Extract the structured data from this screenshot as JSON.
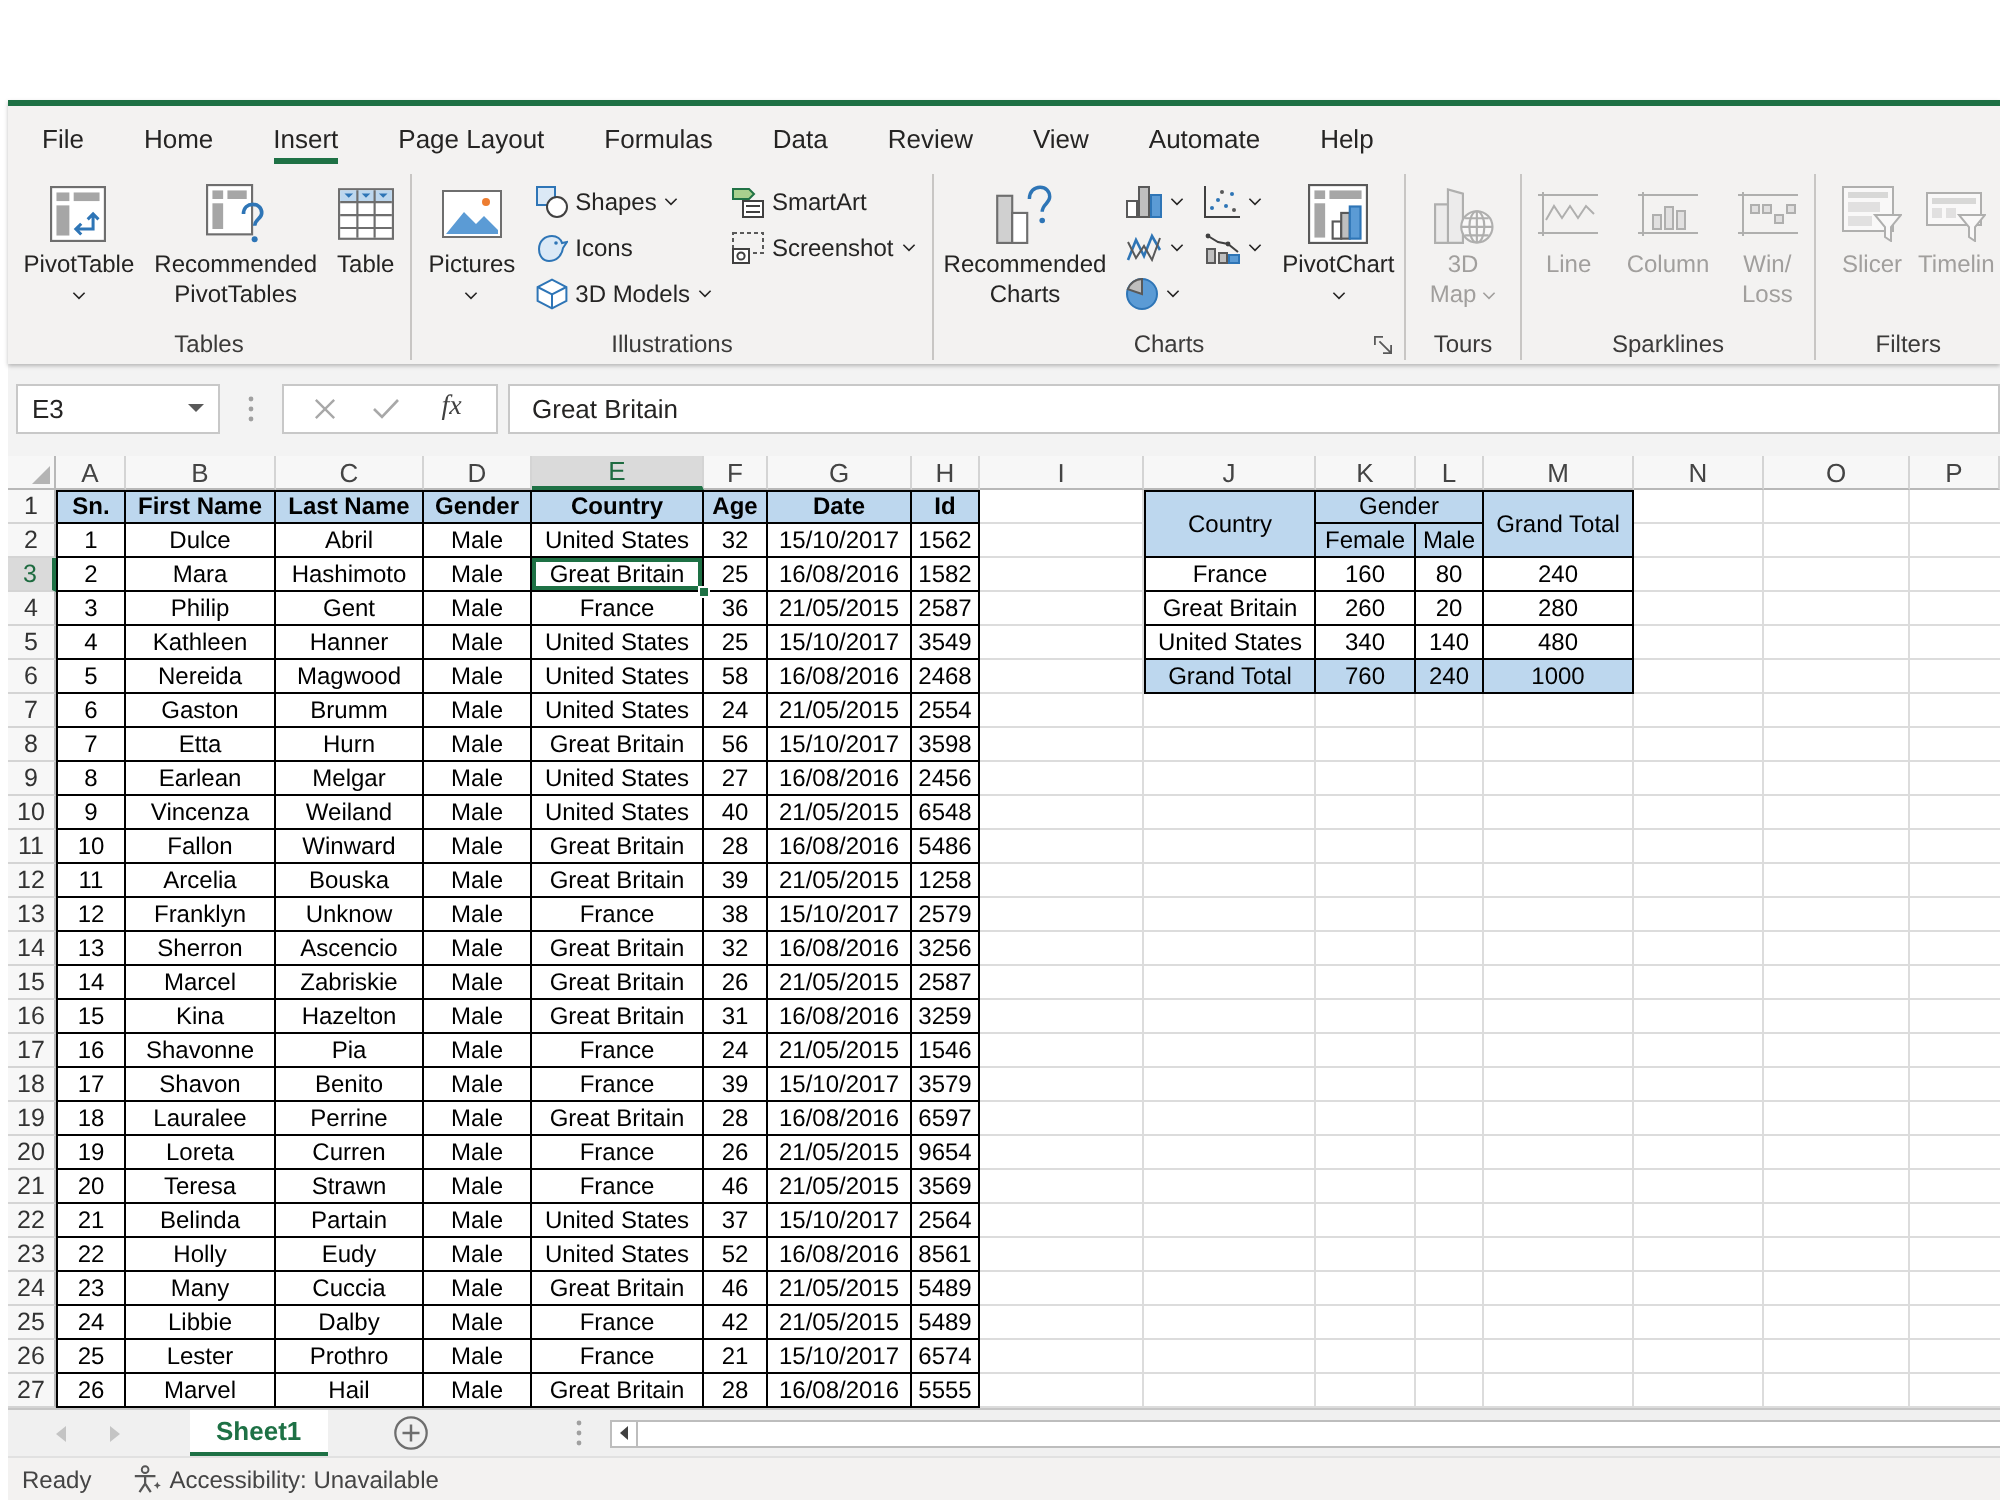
{
  "ribbon": {
    "tabs": [
      {
        "label": "File",
        "selected": false
      },
      {
        "label": "Home",
        "selected": false
      },
      {
        "label": "Insert",
        "selected": true
      },
      {
        "label": "Page Layout",
        "selected": false
      },
      {
        "label": "Formulas",
        "selected": false
      },
      {
        "label": "Data",
        "selected": false
      },
      {
        "label": "Review",
        "selected": false
      },
      {
        "label": "View",
        "selected": false
      },
      {
        "label": "Automate",
        "selected": false
      },
      {
        "label": "Help",
        "selected": false
      }
    ],
    "groups": [
      {
        "label": "Tables",
        "launcher": false,
        "columns": [
          [
            {
              "kind": "large",
              "label": "PivotTable",
              "dropdown": true,
              "disabled": false
            }
          ],
          [
            {
              "kind": "large",
              "label": "Recommended\nPivotTables",
              "dropdown": false,
              "disabled": false
            }
          ],
          [
            {
              "kind": "large",
              "label": "Table",
              "dropdown": false,
              "disabled": false
            }
          ]
        ]
      },
      {
        "label": "Illustrations",
        "launcher": false,
        "columns": [
          [
            {
              "kind": "large",
              "label": "Pictures",
              "dropdown": true,
              "disabled": false
            }
          ],
          [
            {
              "kind": "small",
              "label": "Shapes",
              "dropdown": true,
              "disabled": false
            },
            {
              "kind": "small",
              "label": "Icons",
              "dropdown": false,
              "disabled": false
            },
            {
              "kind": "small",
              "label": "3D Models",
              "dropdown": true,
              "disabled": false
            }
          ],
          [
            {
              "kind": "small",
              "label": "SmartArt",
              "dropdown": false,
              "disabled": false
            },
            {
              "kind": "small",
              "label": "Screenshot",
              "dropdown": true,
              "disabled": false
            }
          ]
        ]
      },
      {
        "label": "Charts",
        "launcher": true,
        "columns": [
          [
            {
              "kind": "large",
              "label": "Recommended\nCharts",
              "dropdown": false,
              "disabled": false
            }
          ],
          [
            {
              "kind": "icon",
              "dropdown": true,
              "disabled": false
            },
            {
              "kind": "icon",
              "dropdown": true,
              "disabled": false
            },
            {
              "kind": "icon",
              "dropdown": true,
              "disabled": false
            }
          ],
          [
            {
              "kind": "icon",
              "dropdown": true,
              "disabled": false
            },
            {
              "kind": "icon",
              "dropdown": true,
              "disabled": false
            }
          ],
          [
            {
              "kind": "large",
              "label": "PivotChart",
              "dropdown": true,
              "disabled": false
            }
          ]
        ]
      },
      {
        "label": "Tours",
        "launcher": false,
        "columns": [
          [
            {
              "kind": "large",
              "label": "3D\nMap",
              "dropdown": true,
              "disabled": true
            }
          ]
        ]
      },
      {
        "label": "Sparklines",
        "launcher": false,
        "columns": [
          [
            {
              "kind": "large",
              "label": "Line",
              "dropdown": false,
              "disabled": true
            }
          ],
          [
            {
              "kind": "large",
              "label": "Column",
              "dropdown": false,
              "disabled": true
            }
          ],
          [
            {
              "kind": "large",
              "label": "Win/\nLoss",
              "dropdown": false,
              "disabled": true
            }
          ]
        ]
      },
      {
        "label": "Filters",
        "launcher": false,
        "columns": [
          [
            {
              "kind": "large",
              "label": "Slicer",
              "dropdown": false,
              "disabled": true
            }
          ],
          [
            {
              "kind": "large",
              "label": "Timelin",
              "dropdown": false,
              "disabled": true
            }
          ]
        ]
      }
    ]
  },
  "formula_bar": {
    "name_box": "E3",
    "controls": [
      {
        "kind": "cancel",
        "disabled": true
      },
      {
        "kind": "enter",
        "disabled": true
      },
      {
        "kind": "function",
        "label": "fx",
        "disabled": false
      }
    ],
    "formula": "Great Britain"
  },
  "sheet": {
    "columns": [
      {
        "letter": "A",
        "selected": false
      },
      {
        "letter": "B",
        "selected": false
      },
      {
        "letter": "C",
        "selected": false
      },
      {
        "letter": "D",
        "selected": false
      },
      {
        "letter": "E",
        "selected": true
      },
      {
        "letter": "F",
        "selected": false
      },
      {
        "letter": "G",
        "selected": false
      },
      {
        "letter": "H",
        "selected": false
      },
      {
        "letter": "I",
        "selected": false
      },
      {
        "letter": "J",
        "selected": false
      },
      {
        "letter": "K",
        "selected": false
      },
      {
        "letter": "L",
        "selected": false
      },
      {
        "letter": "M",
        "selected": false
      },
      {
        "letter": "N",
        "selected": false
      },
      {
        "letter": "O",
        "selected": false
      },
      {
        "letter": "P",
        "selected": false
      }
    ],
    "rows": [
      {
        "number": "1",
        "selected": false
      },
      {
        "number": "2",
        "selected": false
      },
      {
        "number": "3",
        "selected": true
      },
      {
        "number": "4",
        "selected": false
      },
      {
        "number": "5",
        "selected": false
      },
      {
        "number": "6",
        "selected": false
      },
      {
        "number": "7",
        "selected": false
      },
      {
        "number": "8",
        "selected": false
      },
      {
        "number": "9",
        "selected": false
      },
      {
        "number": "10",
        "selected": false
      },
      {
        "number": "11",
        "selected": false
      },
      {
        "number": "12",
        "selected": false
      },
      {
        "number": "13",
        "selected": false
      },
      {
        "number": "14",
        "selected": false
      },
      {
        "number": "15",
        "selected": false
      },
      {
        "number": "16",
        "selected": false
      },
      {
        "number": "17",
        "selected": false
      },
      {
        "number": "18",
        "selected": false
      },
      {
        "number": "19",
        "selected": false
      },
      {
        "number": "20",
        "selected": false
      },
      {
        "number": "21",
        "selected": false
      },
      {
        "number": "22",
        "selected": false
      },
      {
        "number": "23",
        "selected": false
      },
      {
        "number": "24",
        "selected": false
      },
      {
        "number": "25",
        "selected": false
      },
      {
        "number": "26",
        "selected": false
      },
      {
        "number": "27",
        "selected": false
      }
    ],
    "data_table": {
      "headers": [
        "Sn.",
        "First Name",
        "Last Name",
        "Gender",
        "Country",
        "Age",
        "Date",
        "Id"
      ],
      "rows": [
        [
          "1",
          "Dulce",
          "Abril",
          "Male",
          "United States",
          "32",
          "15/10/2017",
          "1562"
        ],
        [
          "2",
          "Mara",
          "Hashimoto",
          "Male",
          "Great Britain",
          "25",
          "16/08/2016",
          "1582"
        ],
        [
          "3",
          "Philip",
          "Gent",
          "Male",
          "France",
          "36",
          "21/05/2015",
          "2587"
        ],
        [
          "4",
          "Kathleen",
          "Hanner",
          "Male",
          "United States",
          "25",
          "15/10/2017",
          "3549"
        ],
        [
          "5",
          "Nereida",
          "Magwood",
          "Male",
          "United States",
          "58",
          "16/08/2016",
          "2468"
        ],
        [
          "6",
          "Gaston",
          "Brumm",
          "Male",
          "United States",
          "24",
          "21/05/2015",
          "2554"
        ],
        [
          "7",
          "Etta",
          "Hurn",
          "Male",
          "Great Britain",
          "56",
          "15/10/2017",
          "3598"
        ],
        [
          "8",
          "Earlean",
          "Melgar",
          "Male",
          "United States",
          "27",
          "16/08/2016",
          "2456"
        ],
        [
          "9",
          "Vincenza",
          "Weiland",
          "Male",
          "United States",
          "40",
          "21/05/2015",
          "6548"
        ],
        [
          "10",
          "Fallon",
          "Winward",
          "Male",
          "Great Britain",
          "28",
          "16/08/2016",
          "5486"
        ],
        [
          "11",
          "Arcelia",
          "Bouska",
          "Male",
          "Great Britain",
          "39",
          "21/05/2015",
          "1258"
        ],
        [
          "12",
          "Franklyn",
          "Unknow",
          "Male",
          "France",
          "38",
          "15/10/2017",
          "2579"
        ],
        [
          "13",
          "Sherron",
          "Ascencio",
          "Male",
          "Great Britain",
          "32",
          "16/08/2016",
          "3256"
        ],
        [
          "14",
          "Marcel",
          "Zabriskie",
          "Male",
          "Great Britain",
          "26",
          "21/05/2015",
          "2587"
        ],
        [
          "15",
          "Kina",
          "Hazelton",
          "Male",
          "Great Britain",
          "31",
          "16/08/2016",
          "3259"
        ],
        [
          "16",
          "Shavonne",
          "Pia",
          "Male",
          "France",
          "24",
          "21/05/2015",
          "1546"
        ],
        [
          "17",
          "Shavon",
          "Benito",
          "Male",
          "France",
          "39",
          "15/10/2017",
          "3579"
        ],
        [
          "18",
          "Lauralee",
          "Perrine",
          "Male",
          "Great Britain",
          "28",
          "16/08/2016",
          "6597"
        ],
        [
          "19",
          "Loreta",
          "Curren",
          "Male",
          "France",
          "26",
          "21/05/2015",
          "9654"
        ],
        [
          "20",
          "Teresa",
          "Strawn",
          "Male",
          "France",
          "46",
          "21/05/2015",
          "3569"
        ],
        [
          "21",
          "Belinda",
          "Partain",
          "Male",
          "United States",
          "37",
          "15/10/2017",
          "2564"
        ],
        [
          "22",
          "Holly",
          "Eudy",
          "Male",
          "United States",
          "52",
          "16/08/2016",
          "8561"
        ],
        [
          "23",
          "Many",
          "Cuccia",
          "Male",
          "Great Britain",
          "46",
          "21/05/2015",
          "5489"
        ],
        [
          "24",
          "Libbie",
          "Dalby",
          "Male",
          "France",
          "42",
          "21/05/2015",
          "5489"
        ],
        [
          "25",
          "Lester",
          "Prothro",
          "Male",
          "France",
          "21",
          "15/10/2017",
          "6574"
        ],
        [
          "26",
          "Marvel",
          "Hail",
          "Male",
          "Great Britain",
          "28",
          "16/08/2016",
          "5555"
        ]
      ]
    },
    "pivot_table": {
      "row_header": "Country",
      "column_header": "Gender",
      "sub_headers": [
        "Female",
        "Male"
      ],
      "total_header": "Grand Total",
      "rows": [
        {
          "label": "France",
          "values": [
            "160",
            "80",
            "240"
          ]
        },
        {
          "label": "Great Britain",
          "values": [
            "260",
            "20",
            "280"
          ]
        },
        {
          "label": "United States",
          "values": [
            "340",
            "140",
            "480"
          ]
        }
      ],
      "total_row": {
        "label": "Grand Total",
        "values": [
          "760",
          "240",
          "1000"
        ]
      }
    }
  },
  "sheet_tabs": {
    "nav": [
      {
        "kind": "previous",
        "disabled": true
      },
      {
        "kind": "next",
        "disabled": true
      }
    ],
    "tabs": [
      {
        "label": "Sheet1",
        "selected": true
      }
    ]
  },
  "status_bar": {
    "mode": "Ready",
    "accessibility": "Accessibility: Unavailable"
  }
}
